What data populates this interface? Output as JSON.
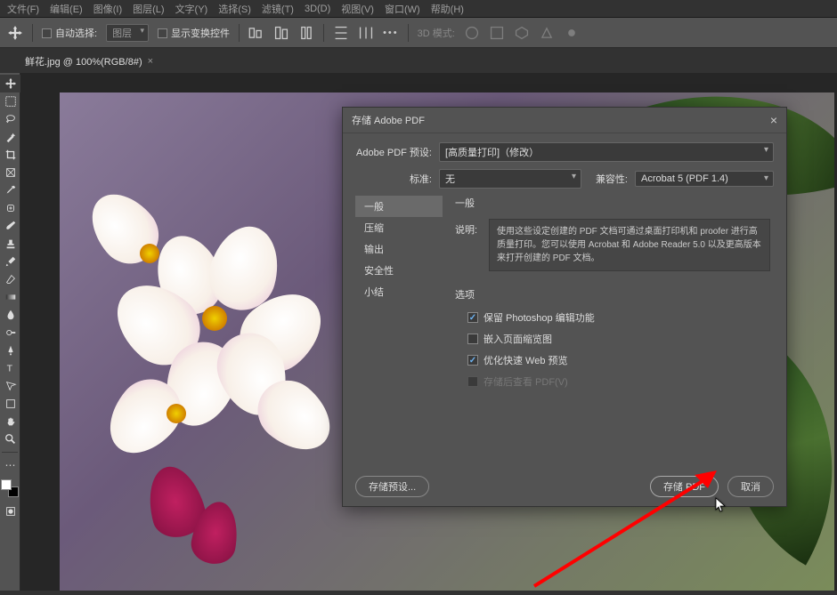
{
  "menubar": [
    "文件(F)",
    "编辑(E)",
    "图像(I)",
    "图层(L)",
    "文字(Y)",
    "选择(S)",
    "滤镜(T)",
    "3D(D)",
    "视图(V)",
    "窗口(W)",
    "帮助(H)"
  ],
  "options": {
    "auto_select": "自动选择:",
    "layer_dropdown": "图层",
    "show_transform": "显示变换控件",
    "mode_3d": "3D 模式:"
  },
  "tab": {
    "label": "鲜花.jpg @ 100%(RGB/8#)"
  },
  "dialog": {
    "title": "存储 Adobe PDF",
    "preset_label": "Adobe PDF 预设:",
    "preset_value": "[高质量打印]（修改）",
    "standard_label": "标准:",
    "standard_value": "无",
    "compat_label": "兼容性:",
    "compat_value": "Acrobat 5 (PDF 1.4)",
    "sidebar": [
      "一般",
      "压缩",
      "输出",
      "安全性",
      "小结"
    ],
    "section_title": "一般",
    "desc_label": "说明:",
    "desc_text": "使用这些设定创建的 PDF 文档可通过桌面打印机和 proofer 进行高质量打印。您可以使用 Acrobat 和 Adobe Reader 5.0 以及更高版本来打开创建的 PDF 文档。",
    "options_title": "选项",
    "opt1": "保留 Photoshop 编辑功能",
    "opt2": "嵌入页面缩览图",
    "opt3": "优化快速 Web 预览",
    "opt4": "存储后查看 PDF(V)",
    "save_preset": "存储预设...",
    "save_pdf": "存储 PDF",
    "cancel": "取消"
  }
}
